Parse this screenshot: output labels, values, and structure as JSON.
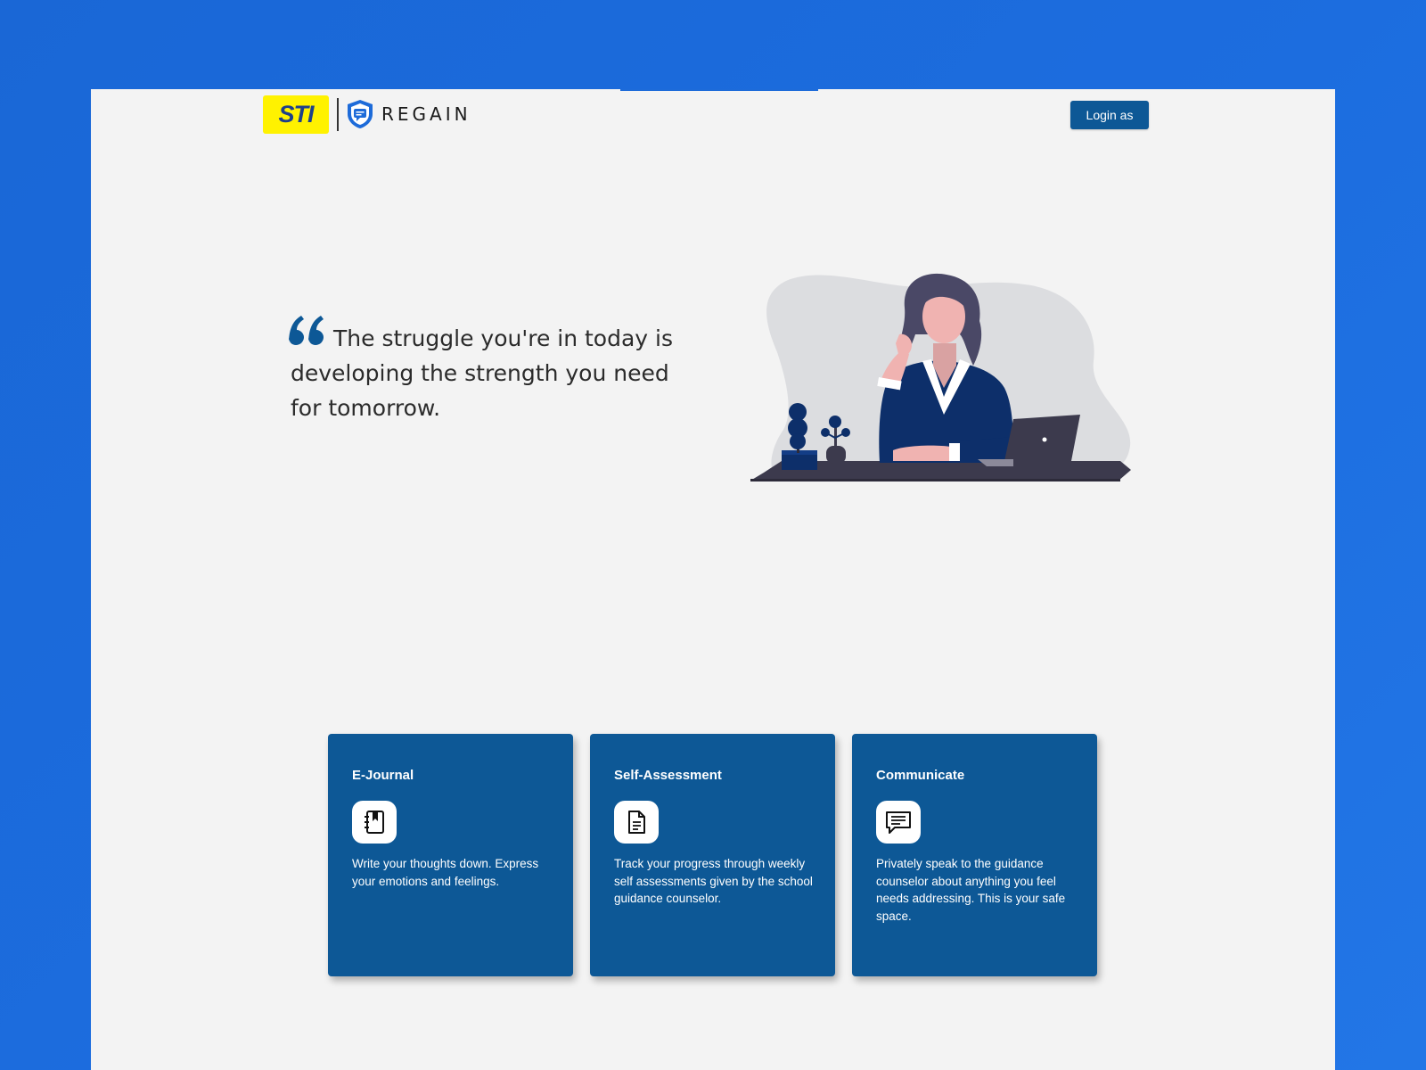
{
  "header": {
    "sti_logo_text": "STI",
    "brand_name": "REGAIN",
    "login_label": "Login as"
  },
  "hero": {
    "quote": "The struggle you're in today is developing the strength you need for tomorrow."
  },
  "cards": [
    {
      "title": "E-Journal",
      "icon": "journal-bookmark-icon",
      "description": "Write your thoughts down. Express your emotions and feelings."
    },
    {
      "title": "Self-Assessment",
      "icon": "document-icon",
      "description": "Track your progress through weekly self assessments given by the school guidance counselor."
    },
    {
      "title": "Communicate",
      "icon": "chat-message-icon",
      "description": "Privately speak to the guidance counselor about anything you feel needs addressing. This is your safe space."
    }
  ],
  "colors": {
    "background": "#1c6ddf",
    "page": "#f3f3f3",
    "primary": "#0d5896",
    "sti_yellow": "#fff200",
    "sti_blue": "#1d3f8a"
  }
}
